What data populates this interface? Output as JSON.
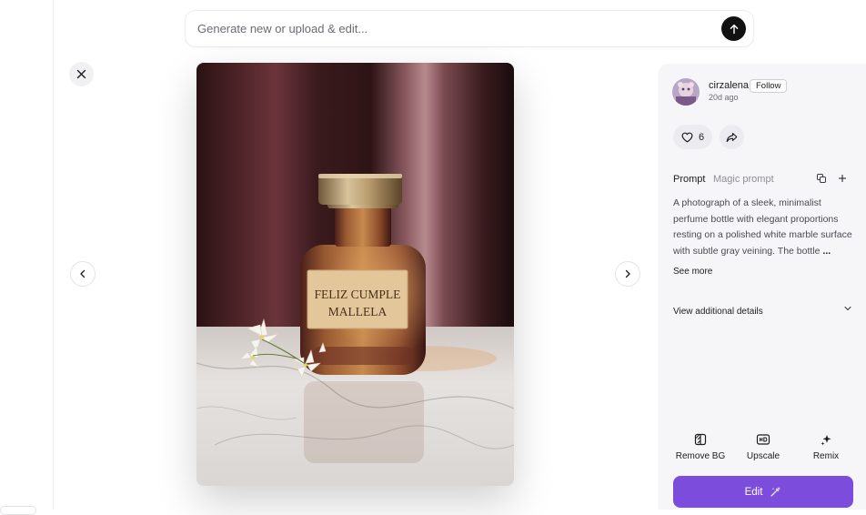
{
  "prompt_bar": {
    "placeholder": "Generate new or upload & edit..."
  },
  "image": {
    "bottle_label_line1": "FELIZ CUMPLE",
    "bottle_label_line2": "MALLELA"
  },
  "author": {
    "username": "cirzalena",
    "follow_label": "Follow",
    "time_ago": "20d ago"
  },
  "actions": {
    "like_count": "6"
  },
  "prompt_tabs": {
    "prompt": "Prompt",
    "magic": "Magic prompt"
  },
  "prompt": {
    "text": "A photograph of a sleek, minimalist perfume bottle with elegant proportions resting on a polished white marble surface with subtle gray veining. The bottle",
    "ellipsis": "...",
    "see_more": "See more"
  },
  "details": {
    "label": "View additional details"
  },
  "tools": {
    "remove_bg": "Remove BG",
    "upscale": "Upscale",
    "remix": "Remix"
  },
  "edit": {
    "label": "Edit"
  },
  "colors": {
    "accent": "#7c4ddd",
    "panel_bg": "#f6f6f8",
    "submit": "#111111"
  },
  "icons": [
    "arrow-up-icon",
    "close-icon",
    "chevron-left-icon",
    "chevron-right-icon",
    "heart-icon",
    "share-icon",
    "copy-icon",
    "plus-icon",
    "chevron-down-icon",
    "remove-bg-icon",
    "hd-icon",
    "sparkle-icon",
    "magic-wand-icon"
  ]
}
